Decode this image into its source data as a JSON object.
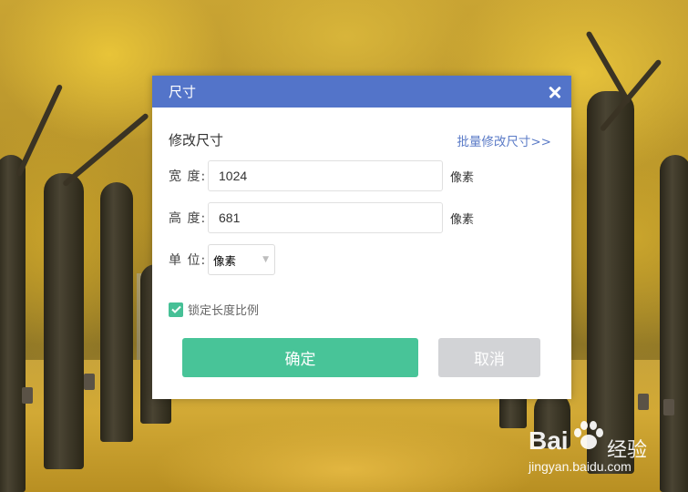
{
  "dialog": {
    "title": "尺寸",
    "section_title": "修改尺寸",
    "batch_link": "批量修改尺寸>>",
    "width_label": "宽 度:",
    "width_value": "1024",
    "width_unit": "像素",
    "height_label": "高 度:",
    "height_value": "681",
    "height_unit": "像素",
    "unit_label": "单 位:",
    "unit_selected": "像素",
    "lock_label": "锁定长度比例",
    "lock_checked": true,
    "ok_label": "确定",
    "cancel_label": "取消"
  },
  "colors": {
    "titlebar": "#5374c9",
    "ok_button": "#48c498",
    "cancel_button": "#d2d3d6",
    "link": "#5b7bc7"
  },
  "watermark": {
    "brand": "Bai",
    "brand_suffix": "经验",
    "url": "jingyan.baidu.com"
  },
  "icons": {
    "close": "close-icon",
    "check": "check-icon",
    "dropdown": "chevron-down-icon",
    "paw": "paw-icon"
  }
}
